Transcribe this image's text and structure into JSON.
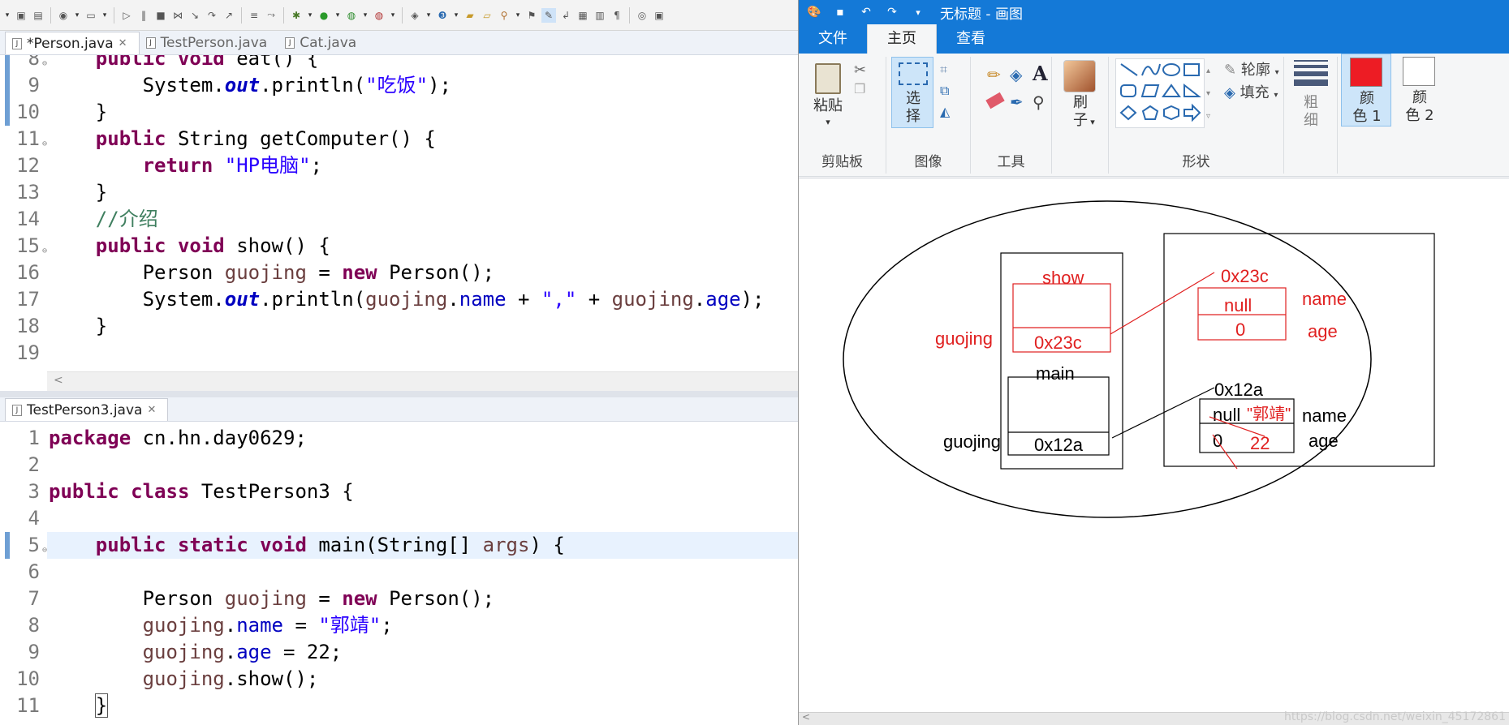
{
  "eclipse": {
    "top_tabs": [
      {
        "label": "*Person.java",
        "active": true
      },
      {
        "label": "TestPerson.java",
        "active": false
      },
      {
        "label": "Cat.java",
        "active": false
      }
    ],
    "bottom_tabs": [
      {
        "label": "TestPerson3.java",
        "active": true
      }
    ],
    "top_editor": {
      "line_numbers": [
        "8",
        "9",
        "10",
        "11",
        "12",
        "13",
        "14",
        "15",
        "16",
        "17",
        "18",
        "19"
      ],
      "lines": {
        "l8": {
          "kw1": "public",
          "kw2": "void",
          "rest": " eat() {"
        },
        "l9": {
          "pre": "System.",
          "field": "out",
          "mid": ".println(",
          "str": "\"吃饭\"",
          "post": ");"
        },
        "l10": {
          "text": "}"
        },
        "l11": {
          "kw": "public",
          "rest": " String getComputer() {"
        },
        "l12": {
          "kw": "return",
          "str": "\"HP电脑\"",
          "post": ";"
        },
        "l13": {
          "text": "}"
        },
        "l14": {
          "comment": "//介绍"
        },
        "l15": {
          "kw1": "public",
          "kw2": "void",
          "rest": " show() {"
        },
        "l16": {
          "type": "Person ",
          "var": "guojing",
          "eq": " = ",
          "kw": "new",
          "rest": " Person();"
        },
        "l17": {
          "pre": "System.",
          "field": "out",
          "mid": ".println(",
          "var1": "guojing",
          "dot1": ".",
          "f1": "name",
          "plus1": " + ",
          "str": "\",\"",
          "plus2": " + ",
          "var2": "guojing",
          "dot2": ".",
          "f2": "age",
          "post": ");"
        },
        "l18": {
          "text": "}"
        }
      }
    },
    "bottom_editor": {
      "line_numbers": [
        "1",
        "2",
        "3",
        "4",
        "5",
        "6",
        "7",
        "8",
        "9",
        "10",
        "11"
      ],
      "lines": {
        "l1": {
          "kw": "package",
          "rest": " cn.hn.day0629;"
        },
        "l3": {
          "kw1": "public",
          "kw2": "class",
          "rest": " TestPerson3 {"
        },
        "l5": {
          "kw1": "public",
          "kw2": "static",
          "kw3": "void",
          "rest": " main(String[] ",
          "param": "args",
          "post": ") {"
        },
        "l7": {
          "type": "Person ",
          "var": "guojing",
          "eq": " = ",
          "kw": "new",
          "rest": " Person();"
        },
        "l8": {
          "var": "guojing",
          "dot": ".",
          "field": "name",
          "eq": " = ",
          "str": "\"郭靖\"",
          "post": ";"
        },
        "l9": {
          "var": "guojing",
          "dot": ".",
          "field": "age",
          "post": " = 22;"
        },
        "l10": {
          "var": "guojing",
          "post": ".show();"
        },
        "l11": {
          "text": "}"
        }
      }
    }
  },
  "paint": {
    "title": "无标题 - 画图",
    "menu_tabs": [
      "文件",
      "主页",
      "查看"
    ],
    "ribbon": {
      "paste": "粘贴",
      "clipboard": "剪贴板",
      "select_1": "选",
      "select_2": "择",
      "image": "图像",
      "tools": "工具",
      "brush_1": "刷",
      "brush_2": "子",
      "shapes": "形状",
      "outline": "轮廓",
      "fill": "填充",
      "size_1": "粗",
      "size_2": "细",
      "color1_a": "颜",
      "color1_b": "色 1",
      "color2_a": "颜",
      "color2_b": "色 2",
      "color1_value": "#ed1c24",
      "color2_value": "#ffffff"
    },
    "diagram": {
      "show_label": "show",
      "main_label": "main",
      "guojing_red": "guojing",
      "guojing_black": "guojing",
      "ref_red": "0x23c",
      "ref_black": "0x12a",
      "heap_addr_red": "0x23c",
      "heap_addr_black": "0x12a",
      "null_red": "null",
      "zero_red": "0",
      "name_red": "name",
      "age_red": "age",
      "null_black": "null",
      "name_value": "\"郭靖\"",
      "zero_black": "0",
      "age_value": "22",
      "name_black": "name",
      "age_black": "age"
    },
    "watermark": "https://blog.csdn.net/weixin_45172861"
  }
}
